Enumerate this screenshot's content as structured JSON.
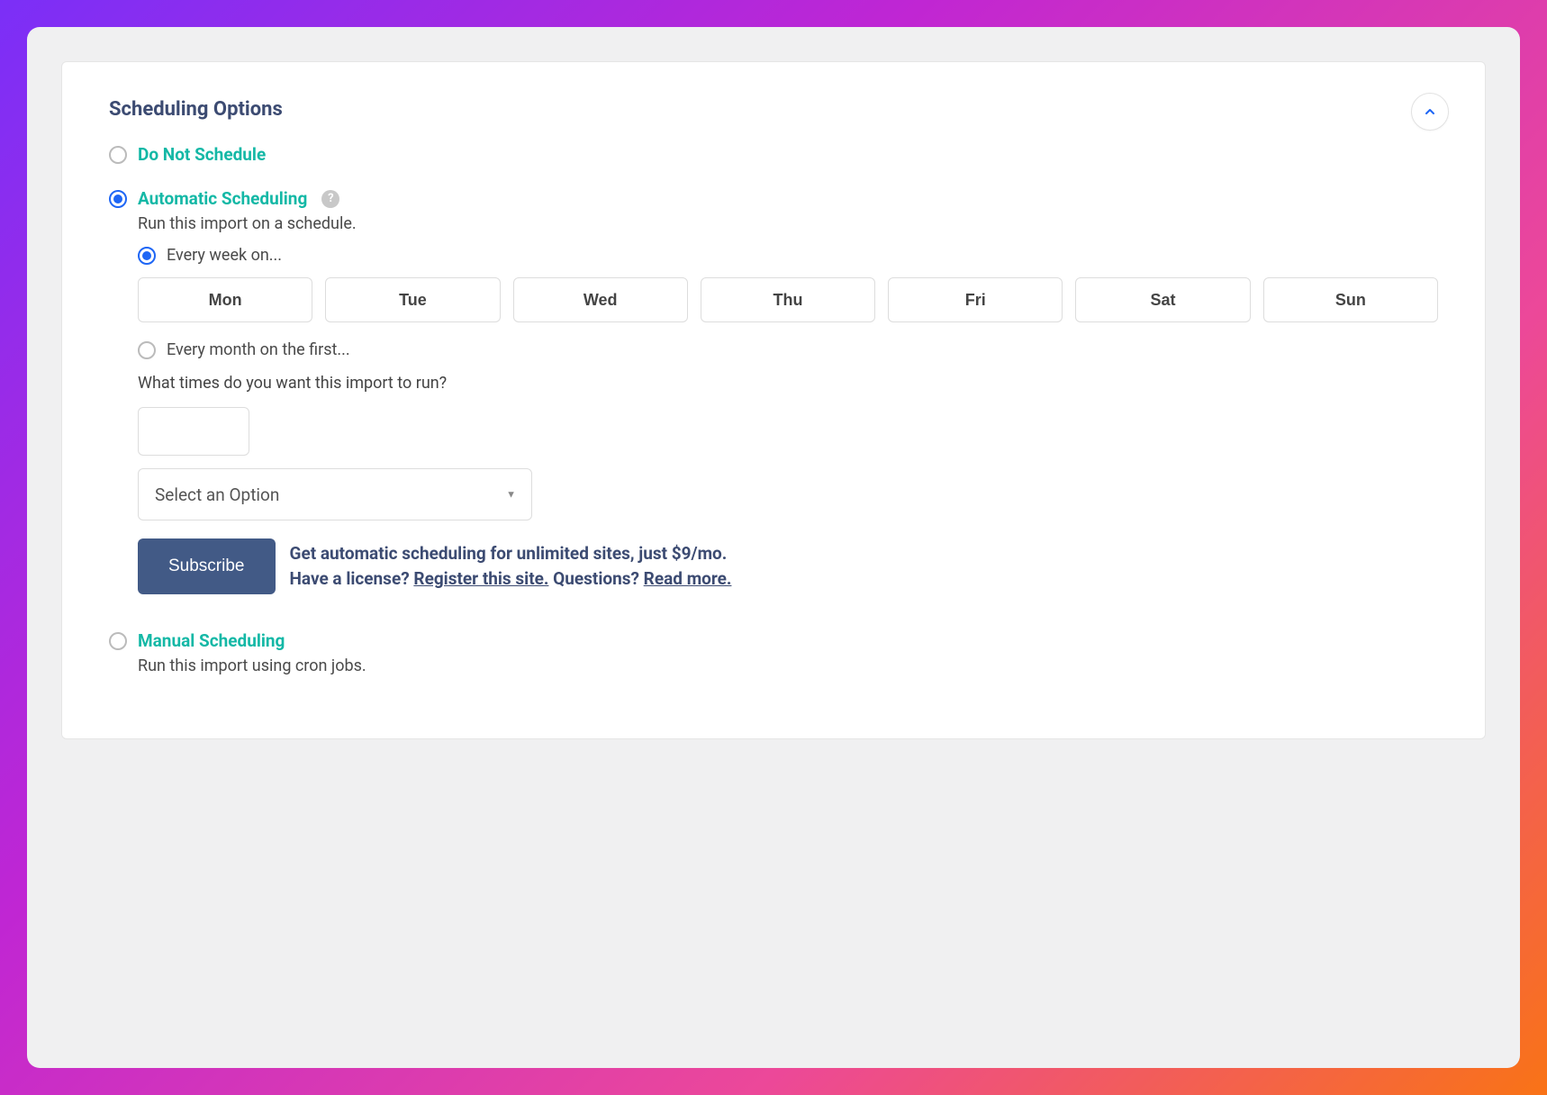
{
  "section_title": "Scheduling Options",
  "options": {
    "do_not_schedule": {
      "label": "Do Not Schedule"
    },
    "automatic": {
      "label": "Automatic Scheduling",
      "desc": "Run this import on a schedule.",
      "weekly": {
        "label": "Every week on...",
        "days": [
          "Mon",
          "Tue",
          "Wed",
          "Thu",
          "Fri",
          "Sat",
          "Sun"
        ]
      },
      "monthly": {
        "label": "Every month on the first..."
      },
      "times_question": "What times do you want this import to run?",
      "select_placeholder": "Select an Option",
      "subscribe_label": "Subscribe",
      "promo_line1": "Get automatic scheduling for unlimited sites, just $9/mo.",
      "promo_line2_a": "Have a license? ",
      "promo_link_register": "Register this site.",
      "promo_line2_b": " Questions? ",
      "promo_link_readmore": "Read more."
    },
    "manual": {
      "label": "Manual Scheduling",
      "desc": "Run this import using cron jobs."
    }
  }
}
